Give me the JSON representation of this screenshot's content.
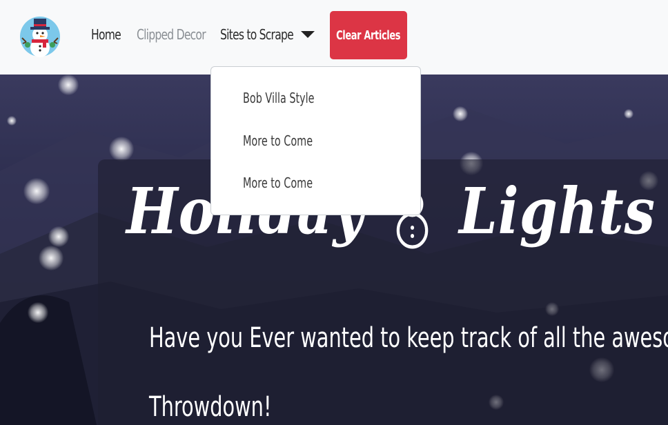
{
  "navbar": {
    "brand_icon": "snowman-icon",
    "links": [
      {
        "label": "Home"
      },
      {
        "label": "Clipped Decor"
      },
      {
        "label": "Sites to Scrape"
      }
    ],
    "clear_button_label": "Clear Articles"
  },
  "dropdown": {
    "items": [
      {
        "label": "Bob Villa Style"
      },
      {
        "label": "More to Come"
      },
      {
        "label": "More to Come"
      }
    ]
  },
  "hero": {
    "title_part1": "Holiday",
    "title_part2": "Lights",
    "text_line1": "Have you Ever wanted to keep track of all the aweso",
    "text_line2": "Throwdown!"
  },
  "colors": {
    "navbar_bg": "#f8f9fa",
    "clear_button": "#dc3545",
    "link_muted": "#8a8f94",
    "link_default": "#2a2a2a",
    "hero_bg": "#2e2f50"
  }
}
